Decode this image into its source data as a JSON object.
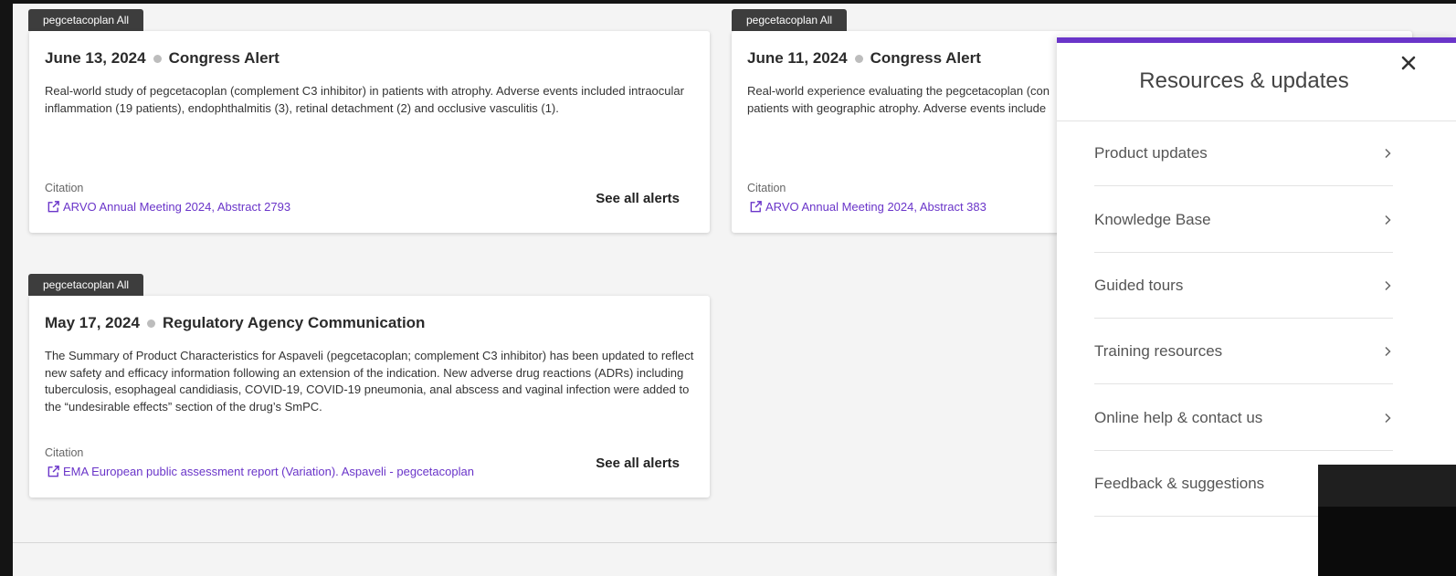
{
  "alerts": [
    {
      "tag": "pegcetacoplan All",
      "date": "June 13, 2024",
      "type": "Congress Alert",
      "body": "Real-world study of pegcetacoplan (complement C3 inhibitor) in patients with atrophy. Adverse events included intraocular inflammation (19 patients), endophthalmitis (3), retinal detachment (2) and occlusive vasculitis (1).",
      "citation_label": "Citation",
      "citation_link": "ARVO Annual Meeting 2024, Abstract 2793",
      "see_all": "See all alerts"
    },
    {
      "tag": "pegcetacoplan All",
      "date": "June 11, 2024",
      "type": "Congress Alert",
      "body": "Real-world experience evaluating the pegcetacoplan (con patients with geographic atrophy. Adverse events include",
      "citation_label": "Citation",
      "citation_link": "ARVO Annual Meeting 2024, Abstract 383"
    },
    {
      "tag": "pegcetacoplan All",
      "date": "May 17, 2024",
      "type": "Regulatory Agency Communication",
      "body": "The Summary of Product Characteristics for Aspaveli (pegcetacoplan; complement C3 inhibitor) has been updated to reflect new safety and efficacy information following an extension of the indication. New adverse drug reactions (ADRs) including tuberculosis, esophageal candidiasis, COVID-19, COVID-19 pneumonia, anal abscess and vaginal infection were added to the “undesirable effects” section of the drug’s SmPC.",
      "citation_label": "Citation",
      "citation_link": "EMA European public assessment report (Variation). Aspaveli - pegcetacoplan",
      "see_all": "See all alerts"
    }
  ],
  "panel": {
    "title": "Resources & updates",
    "close_icon": "close-icon",
    "items": [
      {
        "label": "Product updates"
      },
      {
        "label": "Knowledge Base"
      },
      {
        "label": "Guided tours"
      },
      {
        "label": "Training resources"
      },
      {
        "label": "Online help & contact us"
      },
      {
        "label": "Feedback & suggestions"
      }
    ]
  },
  "colors": {
    "accent": "#6a35c9",
    "tag_bg": "#3d3d3d",
    "link": "#6a35c9"
  }
}
